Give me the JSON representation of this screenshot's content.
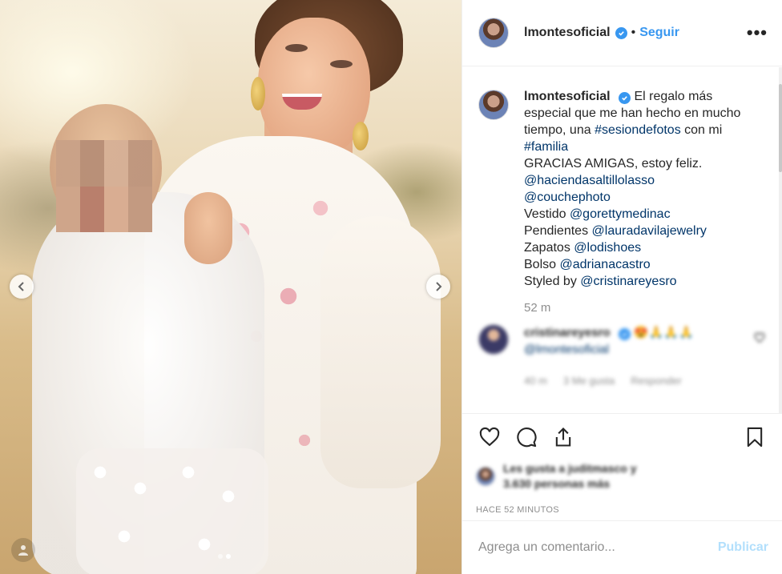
{
  "post": {
    "username": "lmontesoficial",
    "verified": true,
    "separator": "•",
    "follow_label": "Seguir",
    "more_label": "•••"
  },
  "caption": {
    "username": "lmontesoficial",
    "text_1": "El regalo más especial que me han hecho en mucho tiempo, una",
    "hashtag_1": "#sesiondefotos",
    "text_2": "con mi",
    "hashtag_2": "#familia",
    "line_gracias": "GRACIAS AMIGAS, estoy feliz.",
    "mention_hacienda": "@haciendasaltillolasso",
    "mention_couche": "@couchephoto",
    "vestido_label": "Vestido",
    "vestido_mention": "@gorettymedinac",
    "pendientes_label": "Pendientes",
    "pendientes_mention": "@lauradavilajewelry",
    "zapatos_label": "Zapatos",
    "zapatos_mention": "@lodishoes",
    "bolso_label": "Bolso",
    "bolso_mention": "@adrianacastro",
    "styled_label": "Styled by",
    "styled_mention": "@cristinareyesro",
    "time": "52 m"
  },
  "reply": {
    "username": "cristinareyesro",
    "emojis": "😍🙏🙏🙏",
    "mention": "@lmontesoficial",
    "time": "40 m",
    "likes": "3 Me gusta",
    "reply_label": "Responder"
  },
  "likes": {
    "text_1": "Les gusta a juditmasco y",
    "text_2": "3.630 personas más"
  },
  "posted": "HACE 52 MINUTOS",
  "add_comment": {
    "placeholder": "Agrega un comentario...",
    "post_label": "Publicar"
  },
  "carousel": {
    "total": 2,
    "active_index": 1
  },
  "colors": {
    "link": "#3897f0",
    "tag": "#003569",
    "muted": "#8e8e8e",
    "publish_disabled": "#b2dffc"
  },
  "icons": [
    "heart-icon",
    "comment-icon",
    "share-icon",
    "bookmark-icon",
    "verified-icon",
    "chevron-left-icon",
    "chevron-right-icon",
    "user-tag-icon"
  ]
}
